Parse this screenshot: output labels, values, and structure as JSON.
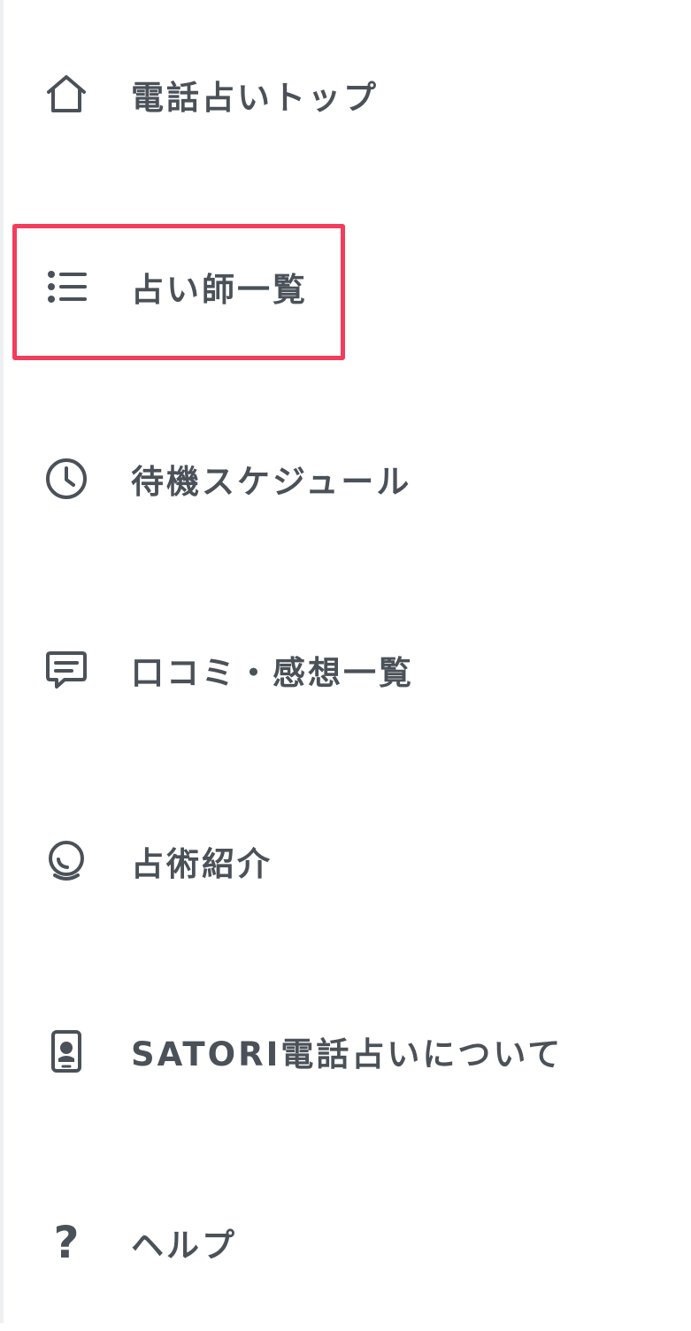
{
  "menu": {
    "items": [
      {
        "label": "電話占いトップ",
        "icon": "home-icon"
      },
      {
        "label": "占い師一覧",
        "icon": "list-icon"
      },
      {
        "label": "待機スケジュール",
        "icon": "clock-icon"
      },
      {
        "label": "口コミ・感想一覧",
        "icon": "chat-bubble-icon"
      },
      {
        "label": "占術紹介",
        "icon": "crystal-ball-icon"
      },
      {
        "label": "SATORI電話占いについて",
        "icon": "phone-device-icon"
      },
      {
        "label": "ヘルプ",
        "icon": "help-icon"
      }
    ]
  },
  "highlight": {
    "target": "占い師一覧",
    "color": "#f23d5c"
  },
  "colors": {
    "text": "#4b5158",
    "icon": "#4b5158",
    "background": "#ffffff",
    "highlight": "#f23d5c"
  }
}
